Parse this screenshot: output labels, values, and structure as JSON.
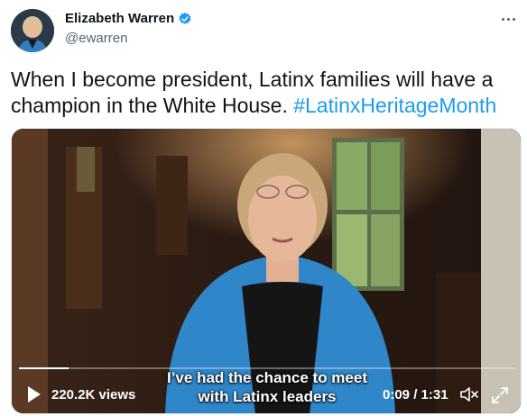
{
  "author": {
    "display_name": "Elizabeth Warren",
    "handle": "@ewarren"
  },
  "tweet": {
    "text": "When I become president, Latinx families will have a champion in the White House.",
    "hashtag": "#LatinxHeritageMonth"
  },
  "video": {
    "caption_line_1": "I’ve had the chance to meet",
    "caption_line_2": "with Latinx leaders",
    "views": "220.2K views",
    "time": "0:09 / 1:31",
    "progress": 0.1
  },
  "icons": {
    "more": "more-icon",
    "verified": "verified-badge-icon",
    "play": "play-icon",
    "mute": "mute-icon",
    "fullscreen": "fullscreen-icon"
  },
  "colors": {
    "link": "#1d9bf0",
    "verified": "#1d9bf0",
    "secondary_text": "#536471"
  }
}
